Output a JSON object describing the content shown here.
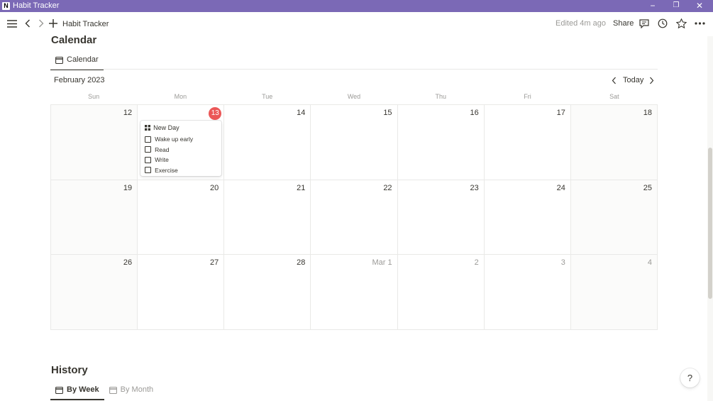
{
  "window": {
    "title": "Habit Tracker",
    "app_icon_letter": "N",
    "controls": {
      "minimize": "−",
      "restore": "❐",
      "close": "✕"
    }
  },
  "topbar": {
    "breadcrumb": "Habit Tracker",
    "edited": "Edited 4m ago",
    "share": "Share"
  },
  "calendar_section": {
    "title": "Calendar",
    "tab": "Calendar",
    "month": "February 2023",
    "today_button": "Today",
    "weekdays": [
      "Sun",
      "Mon",
      "Tue",
      "Wed",
      "Thu",
      "Fri",
      "Sat"
    ],
    "weeks": [
      [
        "12",
        "13",
        "14",
        "15",
        "16",
        "17",
        "18"
      ],
      [
        "19",
        "20",
        "21",
        "22",
        "23",
        "24",
        "25"
      ],
      [
        "26",
        "27",
        "28",
        "Mar 1",
        "2",
        "3",
        "4"
      ]
    ],
    "card": {
      "title": "New Day",
      "items": [
        "Wake up early",
        "Read",
        "Write",
        "Exercise"
      ]
    }
  },
  "history_section": {
    "title": "History",
    "tabs": [
      "By Week",
      "By Month"
    ]
  },
  "help": "?"
}
